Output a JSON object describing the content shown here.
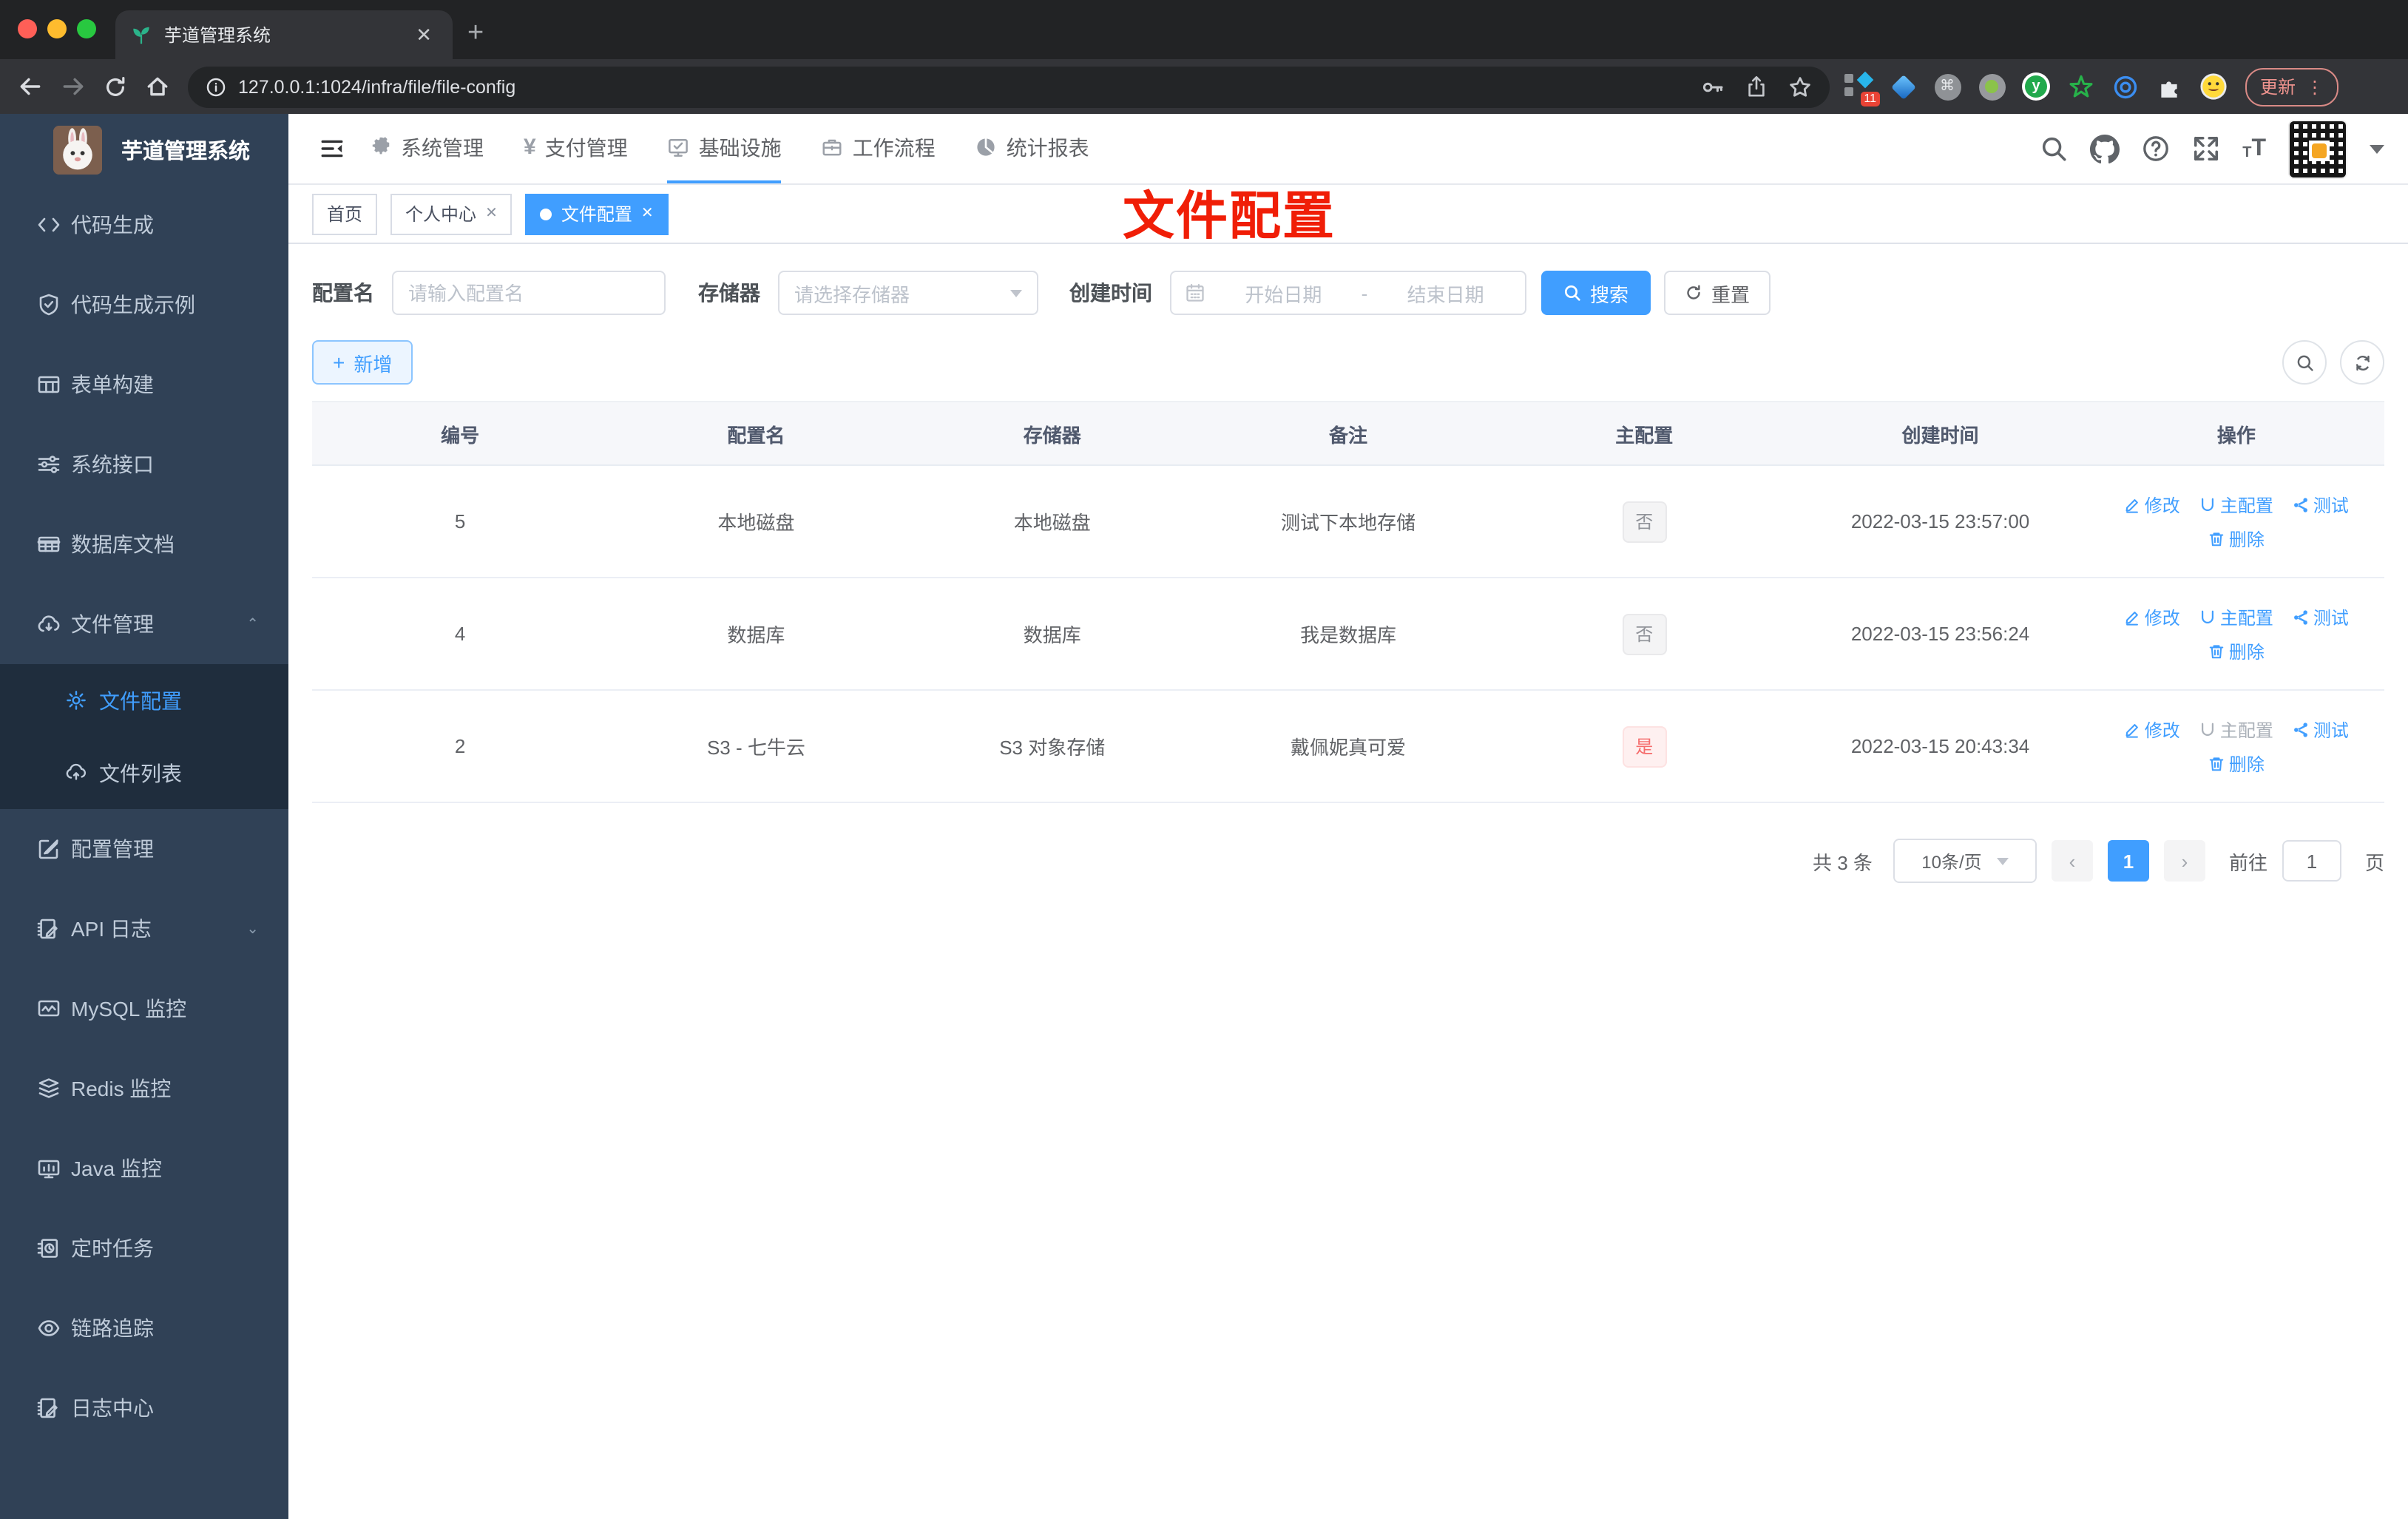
{
  "browser": {
    "tab_title": "芋道管理系统",
    "url": "127.0.0.1:1024/infra/file/file-config",
    "extension_badge": "11",
    "update_label": "更新"
  },
  "sidebar": {
    "app_title": "芋道管理系统",
    "items": [
      {
        "label": "代码生成",
        "icon": "code-icon"
      },
      {
        "label": "代码生成示例",
        "icon": "shield-check-icon"
      },
      {
        "label": "表单构建",
        "icon": "form-grid-icon"
      },
      {
        "label": "系统接口",
        "icon": "sliders-icon"
      },
      {
        "label": "数据库文档",
        "icon": "db-table-icon"
      },
      {
        "label": "文件管理",
        "icon": "cloud-download-icon"
      },
      {
        "label": "文件配置",
        "icon": "gear-icon"
      },
      {
        "label": "文件列表",
        "icon": "cloud-upload-icon"
      },
      {
        "label": "配置管理",
        "icon": "edit-square-icon"
      },
      {
        "label": "API 日志",
        "icon": "doc-edit-icon"
      },
      {
        "label": "MySQL 监控",
        "icon": "chart-monitor-icon"
      },
      {
        "label": "Redis 监控",
        "icon": "layers-icon"
      },
      {
        "label": "Java 监控",
        "icon": "screen-bars-icon"
      },
      {
        "label": "定时任务",
        "icon": "timer-doc-icon"
      },
      {
        "label": "链路追踪",
        "icon": "eye-icon"
      },
      {
        "label": "日志中心",
        "icon": "doc-edit-icon"
      }
    ]
  },
  "topnav": {
    "items": [
      {
        "label": "系统管理",
        "icon": "gear-icon"
      },
      {
        "label": "支付管理",
        "icon": "yen-icon"
      },
      {
        "label": "基础设施",
        "icon": "monitor-check-icon"
      },
      {
        "label": "工作流程",
        "icon": "briefcase-icon"
      },
      {
        "label": "统计报表",
        "icon": "dashboard-icon"
      }
    ]
  },
  "tags": {
    "items": [
      {
        "label": "首页"
      },
      {
        "label": "个人中心"
      },
      {
        "label": "文件配置"
      }
    ]
  },
  "annotation": {
    "text": "文件配置"
  },
  "filters": {
    "name_label": "配置名",
    "name_placeholder": "请输入配置名",
    "storage_label": "存储器",
    "storage_placeholder": "请选择存储器",
    "date_label": "创建时间",
    "date_start_placeholder": "开始日期",
    "date_separator": "-",
    "date_end_placeholder": "结束日期",
    "search_label": "搜索",
    "reset_label": "重置"
  },
  "toolbar": {
    "add_label": "新增"
  },
  "table": {
    "columns": [
      "编号",
      "配置名",
      "存储器",
      "备注",
      "主配置",
      "创建时间",
      "操作"
    ],
    "actions": {
      "edit": "修改",
      "master": "主配置",
      "test": "测试",
      "delete": "删除"
    },
    "rows": [
      {
        "id": "5",
        "name": "本地磁盘",
        "storage": "本地磁盘",
        "remark": "测试下本地存储",
        "master": "否",
        "created": "2022-03-15 23:57:00"
      },
      {
        "id": "4",
        "name": "数据库",
        "storage": "数据库",
        "remark": "我是数据库",
        "master": "否",
        "created": "2022-03-15 23:56:24"
      },
      {
        "id": "2",
        "name": "S3 - 七牛云",
        "storage": "S3 对象存储",
        "remark": "戴佩妮真可爱",
        "master": "是",
        "created": "2022-03-15 20:43:34"
      }
    ]
  },
  "pagination": {
    "total": "共 3 条",
    "page_size": "10条/页",
    "page": "1",
    "goto_label": "前往",
    "goto_value": "1",
    "unit_label": "页"
  },
  "colors": {
    "primary": "#409eff",
    "danger": "#f56c6c",
    "sidebar_bg": "#304156",
    "submenu_bg": "#1f2d3d",
    "annotation_red": "#f01e07"
  }
}
